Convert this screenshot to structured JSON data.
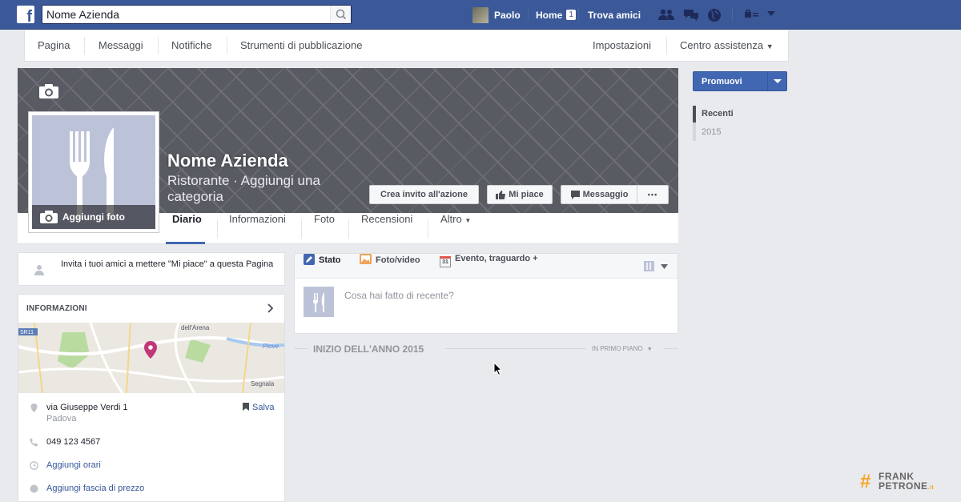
{
  "topbar": {
    "logo": "f",
    "search_value": "Nome Azienda",
    "user_name": "Paolo",
    "home_label": "Home",
    "home_count": "1",
    "find_friends": "Trova amici",
    "icons": [
      "friends-icon",
      "messages-icon",
      "globe-icon",
      "settings-icon",
      "chevron-down-icon"
    ]
  },
  "pagenav": {
    "items": [
      "Pagina",
      "Messaggi",
      "Notifiche",
      "Strumenti di pubblicazione"
    ],
    "settings": "Impostazioni",
    "help": "Centro assistenza"
  },
  "cover": {
    "page_name": "Nome Azienda",
    "category": "Ristorante · Aggiungi una categoria",
    "add_photo": "Aggiungi foto",
    "buttons": {
      "cta": "Crea invito all'azione",
      "like": "Mi piace",
      "message": "Messaggio",
      "more": "•••"
    }
  },
  "tabs": [
    "Diario",
    "Informazioni",
    "Foto",
    "Recensioni",
    "Altro"
  ],
  "invite": {
    "text": "Invita i tuoi amici a mettere \"Mi piace\" a questa Pagina"
  },
  "info": {
    "heading": "INFORMAZIONI",
    "map_labels": {
      "road": "SR11",
      "area1": "dell'Arena",
      "river": "Piove",
      "area2": "Segnala"
    },
    "address": "via Giuseppe Verdi 1",
    "city": "Padova",
    "save": "Salva",
    "phone": "049 123 4567",
    "add_hours": "Aggiungi orari",
    "add_price": "Aggiungi fascia di prezzo"
  },
  "composer": {
    "tabs": [
      "Stato",
      "Foto/video",
      "Evento, traguardo +"
    ],
    "calendar_num": "31",
    "placeholder": "Cosa hai fatto di recente?"
  },
  "timeline": {
    "heading": "INIZIO DELL'ANNO 2015",
    "pinned": "IN PRIMO PIANO"
  },
  "sidebar": {
    "promote": "Promuovi",
    "years": [
      "Recenti",
      "2015"
    ]
  },
  "watermark": {
    "hash": "#",
    "line1": "FRANK",
    "line2": "PETRONE",
    "suffix": ".it"
  },
  "colors": {
    "brand_blue": "#3b5998",
    "button_blue": "#4267b2",
    "accent_orange": "#f5a623"
  }
}
